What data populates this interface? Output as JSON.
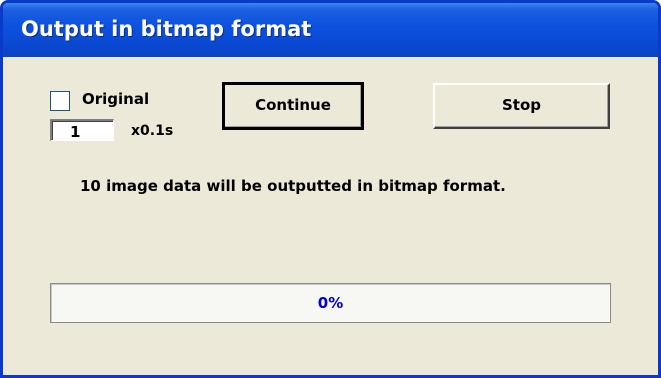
{
  "window": {
    "title": "Output in bitmap format"
  },
  "controls": {
    "original_label": "Original",
    "original_checked": false,
    "interval_value": "1",
    "interval_unit": "x0.1s",
    "continue_label": "Continue",
    "stop_label": "Stop"
  },
  "message": "10 image data will be outputted in bitmap format.",
  "progress": {
    "value": 0,
    "label": "0%"
  },
  "colors": {
    "titlebar": "#0a49d4",
    "dialog_bg": "#ece9d8",
    "progress_text": "#0000cc"
  }
}
